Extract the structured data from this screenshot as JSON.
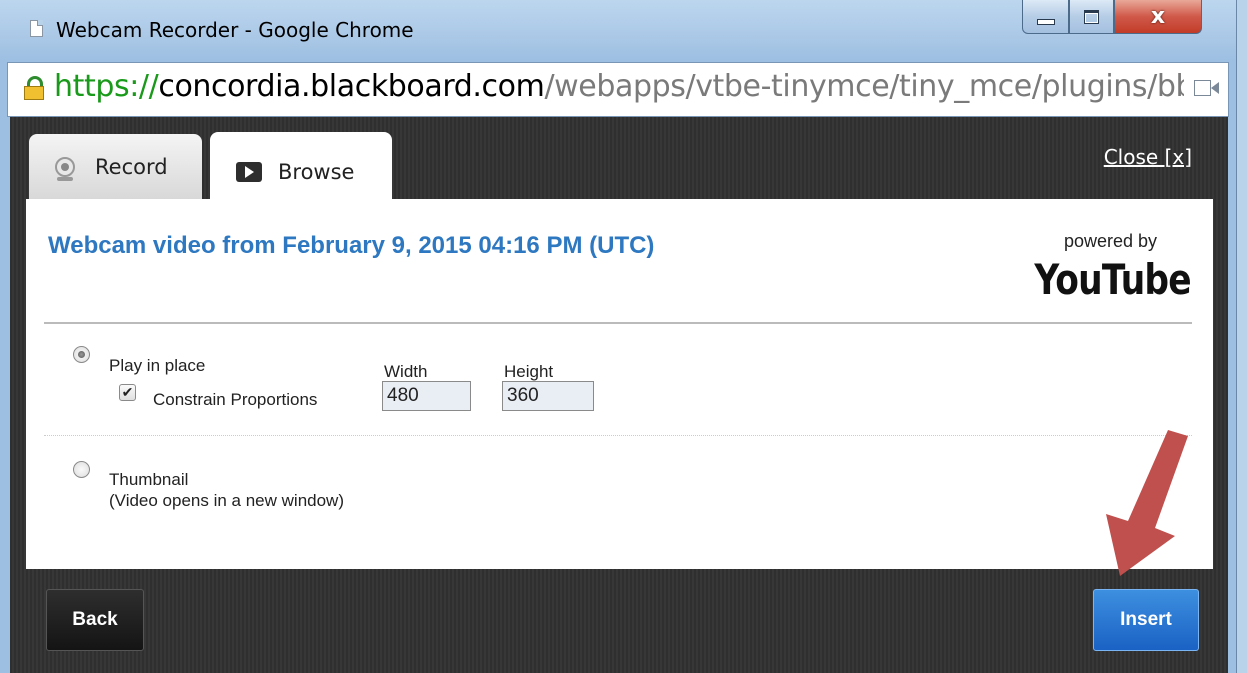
{
  "window": {
    "title": "Webcam Recorder - Google Chrome",
    "close_glyph": "x"
  },
  "address_bar": {
    "url_scheme": "https://",
    "url_host": "concordia.blackboard.com",
    "url_path": "/webapps/vtbe-tinymce/tiny_mce/plugins/bb_recor"
  },
  "tabs": [
    {
      "label": "Record",
      "icon": "webcam-icon",
      "active": false
    },
    {
      "label": "Browse",
      "icon": "play-icon",
      "active": true
    }
  ],
  "close_link": "Close [x]",
  "video": {
    "title": "Webcam video from February 9, 2015 04:16 PM (UTC)",
    "powered_by": "powered by",
    "brand": "YouTube"
  },
  "options": {
    "play_in_place": {
      "label": "Play in place",
      "selected": true
    },
    "constrain": {
      "label": "Constrain Proportions",
      "checked": true,
      "check_glyph": "✔"
    },
    "width": {
      "label": "Width",
      "value": "480"
    },
    "height": {
      "label": "Height",
      "value": "360"
    },
    "thumbnail": {
      "label": "Thumbnail",
      "note": "(Video opens in a new window)",
      "selected": false
    }
  },
  "footer": {
    "back_label": "Back",
    "insert_label": "Insert"
  },
  "colors": {
    "title_blue": "#2d78c0",
    "insert_blue": "#1a62c4",
    "annotation_arrow": "#c0504d"
  }
}
